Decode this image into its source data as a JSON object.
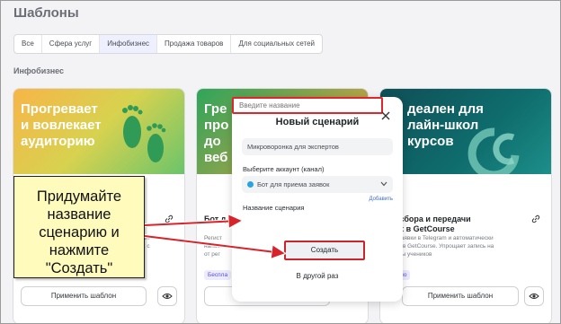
{
  "page": {
    "title": "Шаблоны",
    "section_title": "Инфобизнес"
  },
  "tabs": [
    {
      "label": "Все"
    },
    {
      "label": "Сфера услуг"
    },
    {
      "label": "Инфобизнес"
    },
    {
      "label": "Продажа товаров"
    },
    {
      "label": "Для социальных сетей"
    }
  ],
  "cards": [
    {
      "banner": "Прогревает\nи вовлекает\nаудиторию",
      "body_desc": "ходит\nных с",
      "apply_label": "Применить шаблон"
    },
    {
      "banner": "Гре\nпро\nдо\nвеб",
      "body_title": "Бот д",
      "body_desc": "Регист\nнапом\nот рег",
      "badge": "Беспла",
      "apply_label": "Применить шаблон"
    },
    {
      "banner": "деален для\nлайн-школ\nкурсов",
      "body_title": "ля сбора и передачи\nных в GetCourse",
      "body_desc": "ает заявки в Telegram и автоматически\nет их в GetCourse. Упрощает запись на\nй базы учеников",
      "badge": "латно",
      "apply_label": "Применить шаблон"
    }
  ],
  "modal": {
    "title": "Новый сценарий",
    "template_value": "Микроворонка для экспертов",
    "account_label": "Выберите аккаунт (канал)",
    "account_value": "Бот для приема заявок",
    "add_link": "Добавить",
    "name_label": "Название сценария",
    "name_placeholder": "Введите название",
    "create_label": "Создать",
    "later_label": "В другой раз"
  },
  "callout": {
    "text": "Придумайте название сценарию и нажмите \"Создать\""
  },
  "colors": {
    "accent_red": "#d9232a",
    "callout_bg": "#fffbbd",
    "link_blue": "#3b6ee0"
  }
}
